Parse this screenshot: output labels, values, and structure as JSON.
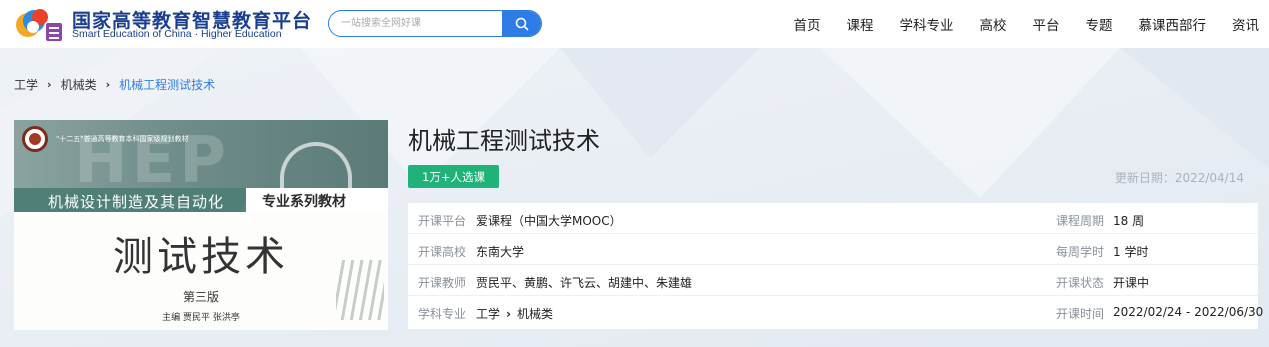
{
  "header": {
    "logo_cn": "国家高等教育智慧教育平台",
    "logo_en": "Smart Education of China · Higher Education",
    "search_placeholder": "一站搜索全网好课",
    "nav": [
      "首页",
      "课程",
      "学科专业",
      "高校",
      "平台",
      "专题",
      "慕课西部行",
      "资讯"
    ]
  },
  "breadcrumb": {
    "items": [
      "工学",
      "机械类"
    ],
    "current": "机械工程测试技术"
  },
  "cover": {
    "series_note": "\"十二五\"普通高等教育本科国家级规划教材",
    "band_left": "机械设计制造及其自动化",
    "band_right": "专业系列教材",
    "title": "测试技术",
    "edition": "第三版",
    "authors": "主编  贾民平  张洪亭",
    "watermark": "HEP"
  },
  "course": {
    "title": "机械工程测试技术",
    "enroll_badge": "1万+人选课",
    "update_date": "更新日期：2022/04/14"
  },
  "info": {
    "rows": [
      {
        "label_l": "开课平台",
        "value_l": "爱课程（中国大学MOOC）",
        "label_r": "课程周期",
        "value_r": "18 周"
      },
      {
        "label_l": "开课高校",
        "value_l": "东南大学",
        "label_r": "每周学时",
        "value_r": "1 学时"
      },
      {
        "label_l": "开课教师",
        "value_l": "贾民平、黄鹏、许飞云、胡建中、朱建雄",
        "label_r": "开课状态",
        "value_r": "开课中"
      },
      {
        "label_l": "学科专业",
        "value_l_a": "工学",
        "value_l_b": "机械类",
        "label_r": "开课时间",
        "value_r": "2022/02/24 - 2022/06/30"
      }
    ]
  },
  "colors": {
    "accent": "#2e7de6",
    "badge": "#1fb37a",
    "brand": "#1a3f8f"
  }
}
